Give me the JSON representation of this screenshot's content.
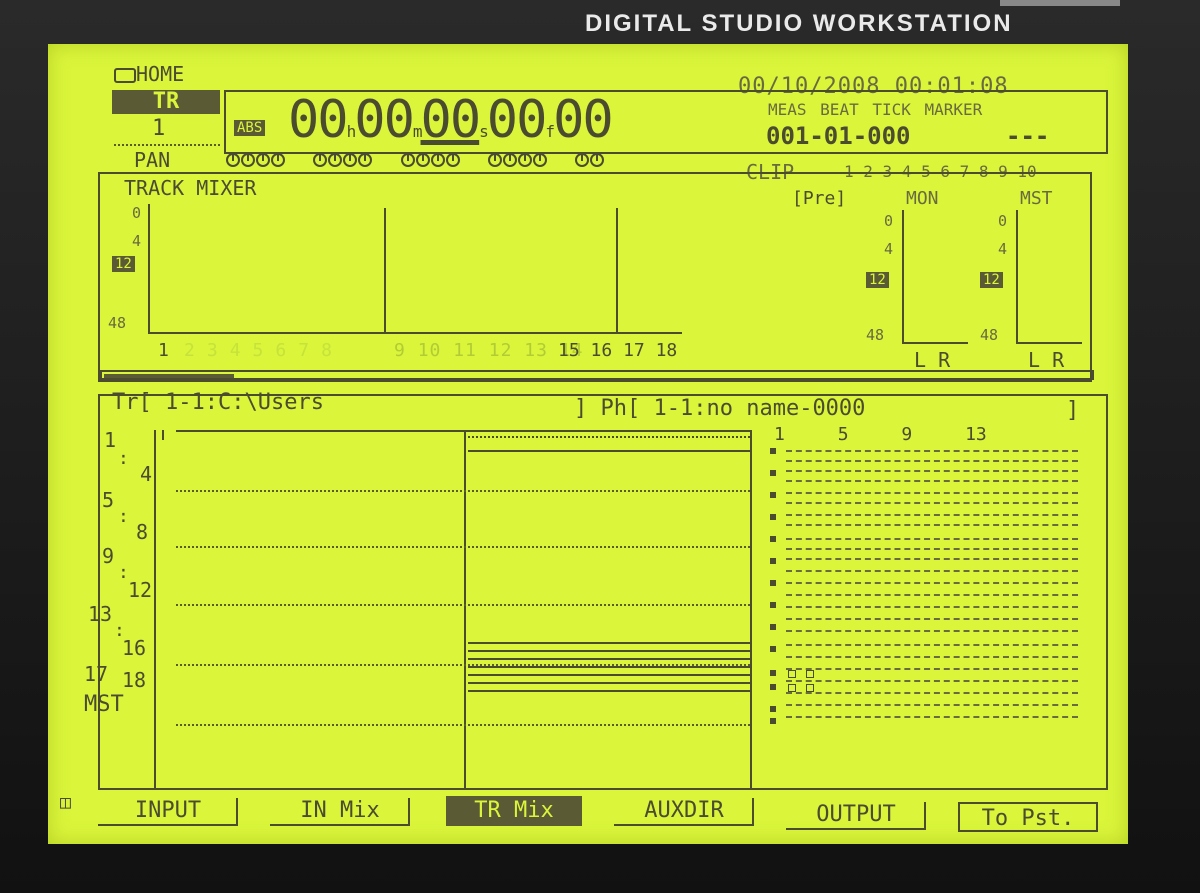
{
  "header": {
    "brand": "DIGITAL STUDIO WORKSTATION"
  },
  "status": {
    "home_label": "HOME",
    "mode_label": "TR",
    "track_number": "1",
    "datetime": "00/10/2008 00:01:08"
  },
  "time": {
    "abs_label": "ABS",
    "hours": "00",
    "hours_unit": "h",
    "minutes": "00",
    "minutes_unit": "m",
    "seconds": "00",
    "seconds_unit": "s",
    "frames": "00",
    "frames_unit": "f",
    "subframes": "00"
  },
  "position": {
    "meas_label": "MEAS",
    "beat_label": "BEAT",
    "tick_label": "TICK",
    "marker_label": "MARKER",
    "value": "001-01-000",
    "marker_value": "---"
  },
  "pan": {
    "label": "PAN",
    "clip_label": "CLIP",
    "clip_numbers": "1 2 3 4 5 6 7 8 9 10"
  },
  "mixer": {
    "title": "TRACK MIXER",
    "pre_label": "[Pre]",
    "mon_label": "MON",
    "mst_label": "MST",
    "scale": [
      "0",
      "4",
      "12",
      "48"
    ],
    "track_numbers": [
      "1",
      "2",
      "3",
      "4",
      "5",
      "6",
      "7",
      "8",
      "9",
      "10",
      "11",
      "12",
      "13",
      "14",
      "15",
      "16",
      "17",
      "18"
    ],
    "lr_label": "L R"
  },
  "track_info": {
    "tr_label": "Tr[",
    "tr_value": "1-1:C:\\Users",
    "tr_close": "]",
    "ph_label": "Ph[",
    "ph_value": "1-1:no name-0000",
    "ph_close": "]"
  },
  "tracks": {
    "labels": [
      {
        "a": "1",
        "b": "4"
      },
      {
        "a": "5",
        "b": "8"
      },
      {
        "a": "9",
        "b": "12"
      },
      {
        "a": "13",
        "b": "16"
      },
      {
        "a": "17",
        "b": "18"
      }
    ],
    "mst_label": "MST"
  },
  "matrix": {
    "columns": [
      "1",
      "5",
      "9",
      "13"
    ]
  },
  "tabs": [
    "INPUT",
    "IN Mix",
    "TR Mix",
    "AUXDIR",
    "OUTPUT",
    "To Pst."
  ],
  "colors": {
    "lcd_background": "#daf53a",
    "lcd_ink": "#4b4b30"
  }
}
